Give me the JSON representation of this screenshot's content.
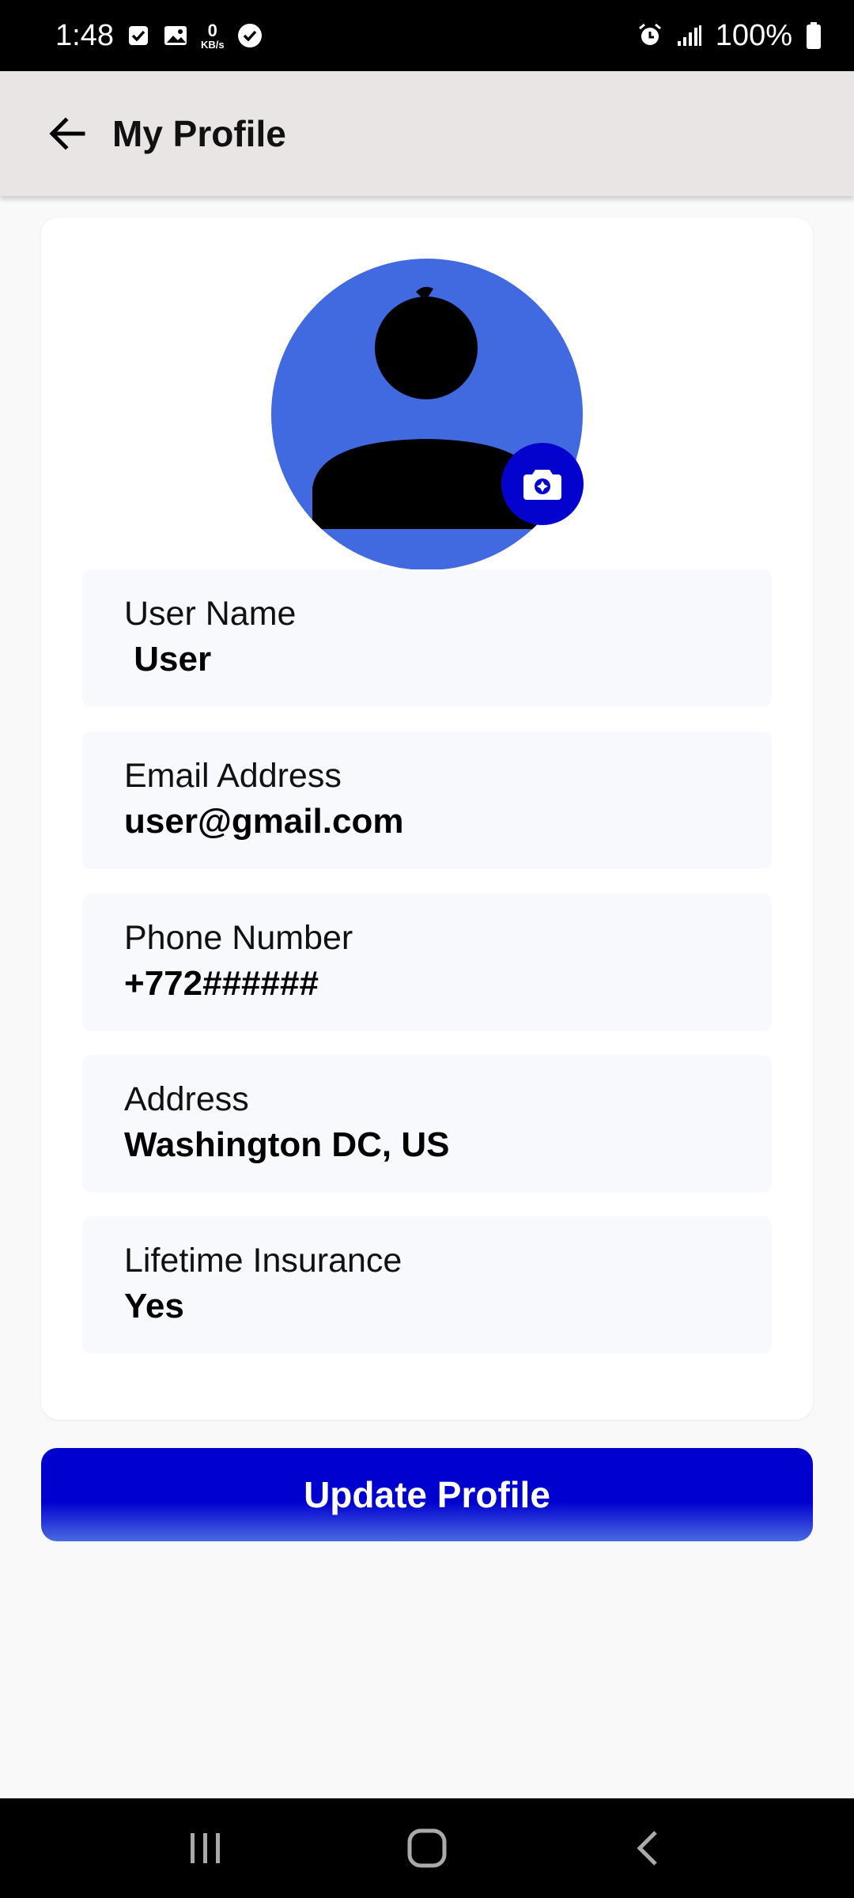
{
  "status_bar": {
    "time": "1:48",
    "net_speed_value": "0",
    "net_speed_unit": "KB/s",
    "battery": "100%"
  },
  "header": {
    "title": "My Profile"
  },
  "fields": [
    {
      "label": "User Name",
      "value": " User"
    },
    {
      "label": "Email Address",
      "value": "user@gmail.com"
    },
    {
      "label": "Phone Number",
      "value": "+772######"
    },
    {
      "label": "Address",
      "value": "Washington DC, US"
    },
    {
      "label": "Lifetime Insurance",
      "value": "Yes"
    }
  ],
  "actions": {
    "update_label": "Update Profile"
  },
  "colors": {
    "accent": "#0403cd",
    "avatar_bg": "#4169e0",
    "header_bg": "#e9e5e4",
    "field_bg": "#f8f9fd"
  },
  "icons": {
    "back": "arrow-left-icon",
    "camera": "camera-icon",
    "nav_recents": "recents-icon",
    "nav_home": "home-icon",
    "nav_back": "chevron-left-icon"
  }
}
